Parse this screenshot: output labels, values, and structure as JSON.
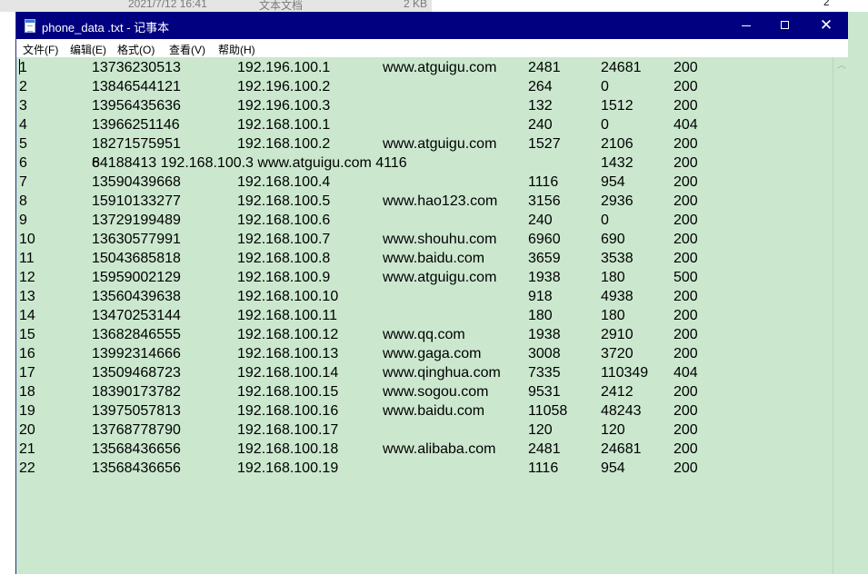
{
  "explorer": {
    "date": "2021/7/12 16:41",
    "type": "文本文档",
    "size": "2 KB",
    "corner": "2"
  },
  "window": {
    "title": "phone_data .txt - 记事本",
    "minimize": "—",
    "maximize": "□",
    "close": "✕"
  },
  "menu": [
    "文件(F)",
    "编辑(E)",
    "格式(O)",
    "查看(V)",
    "帮助(H)"
  ],
  "lines": [
    [
      "1",
      "13736230513",
      "192.196.100.1",
      "www.atguigu.com",
      "2481",
      "24681",
      "200"
    ],
    [
      "2",
      "13846544121",
      "192.196.100.2",
      "",
      "264",
      "0",
      "200"
    ],
    [
      "3",
      "13956435636",
      "192.196.100.3",
      "",
      "132",
      "1512",
      "200"
    ],
    [
      "4",
      "13966251146",
      "192.168.100.1",
      "",
      "240",
      "0",
      "404"
    ],
    [
      "5",
      "18271575951",
      "192.168.100.2",
      "www.atguigu.com",
      "1527",
      "2106",
      "200"
    ],
    [
      "6",
      "84188413  192.168.100.3            www.atguigu.com     4116",
      "",
      "",
      "",
      "1432",
      "200",
      ""
    ],
    [
      "7",
      "13590439668",
      "192.168.100.4",
      "",
      "1116",
      "954",
      "200"
    ],
    [
      "8",
      "15910133277",
      "192.168.100.5",
      "www.hao123.com",
      "3156",
      "2936",
      "200"
    ],
    [
      "9",
      "13729199489",
      "192.168.100.6",
      "",
      "240",
      "0",
      "200"
    ],
    [
      "10",
      "13630577991",
      "192.168.100.7",
      "www.shouhu.com",
      "6960",
      "690",
      "200"
    ],
    [
      "11",
      "15043685818",
      "192.168.100.8",
      "www.baidu.com",
      "3659",
      "3538",
      "200"
    ],
    [
      "12",
      "15959002129",
      "192.168.100.9",
      "www.atguigu.com",
      "1938",
      "180",
      "500"
    ],
    [
      "13",
      "13560439638",
      "192.168.100.10",
      "",
      "918",
      "4938",
      "200"
    ],
    [
      "14",
      "13470253144",
      "192.168.100.11",
      "",
      "180",
      "180",
      "200"
    ],
    [
      "15",
      "13682846555",
      "192.168.100.12",
      "www.qq.com",
      "1938",
      "2910",
      "200"
    ],
    [
      "16",
      "13992314666",
      "192.168.100.13",
      "www.gaga.com",
      "3008",
      "3720",
      "200"
    ],
    [
      "17",
      "13509468723",
      "192.168.100.14",
      "www.qinghua.com",
      "7335",
      "110349",
      "404"
    ],
    [
      "18",
      "18390173782",
      "192.168.100.15",
      "www.sogou.com",
      "9531",
      "2412",
      "200"
    ],
    [
      "19",
      "13975057813",
      "192.168.100.16",
      "www.baidu.com",
      "11058",
      "48243",
      "200"
    ],
    [
      "20",
      "13768778790",
      "192.168.100.17",
      "",
      "120",
      "120",
      "200"
    ],
    [
      "21",
      "13568436656",
      "192.168.100.18",
      "www.alibaba.com",
      "2481",
      "24681",
      "200"
    ],
    [
      "22",
      "13568436656",
      "192.168.100.19",
      "",
      "1116",
      "954",
      "200"
    ]
  ]
}
